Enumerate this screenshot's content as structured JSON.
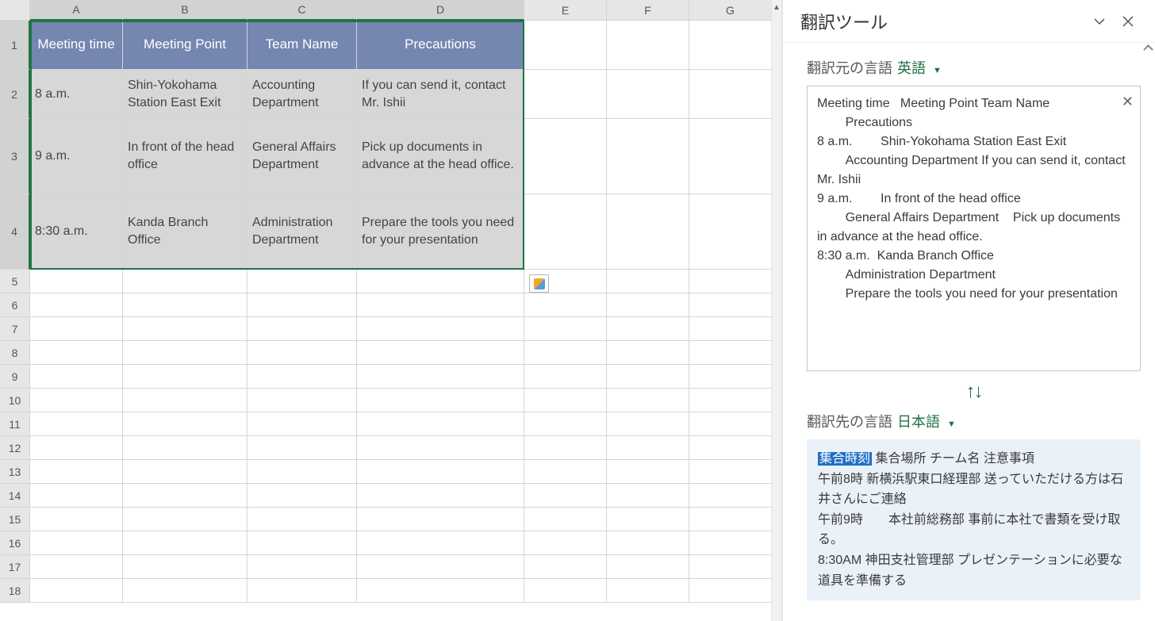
{
  "columns": [
    "A",
    "B",
    "C",
    "D",
    "E",
    "F",
    "G"
  ],
  "rows": [
    "1",
    "2",
    "3",
    "4",
    "5",
    "6",
    "7",
    "8",
    "9",
    "10",
    "11",
    "12",
    "13",
    "14",
    "15",
    "16",
    "17",
    "18"
  ],
  "table": {
    "header": {
      "a": "Meeting time",
      "b": "Meeting Point",
      "c": "Team Name",
      "d": "Precautions"
    },
    "rows": [
      {
        "a": "8 a.m.",
        "b": "Shin-Yokohama Station East Exit",
        "c": "Accounting Department",
        "d": "If you can send it, contact Mr. Ishii"
      },
      {
        "a": "9 a.m.",
        "b": "In front of the head office",
        "c": "General Affairs Department",
        "d": "Pick up documents in advance at the head office."
      },
      {
        "a": "8:30 a.m.",
        "b": "Kanda Branch Office",
        "c": "Administration Department",
        "d": "Prepare the tools you need for your presentation"
      }
    ]
  },
  "pane": {
    "title": "翻訳ツール",
    "source_label": "翻訳元の言語",
    "source_lang": "英語",
    "target_label": "翻訳先の言語",
    "target_lang": "日本語",
    "source_text_lines": [
      "Meeting time   Meeting Point Team Name",
      "        Precautions",
      "8 a.m.        Shin-Yokohama Station East Exit",
      "        Accounting Department If you can send it, contact Mr. Ishii",
      "9 a.m.        In front of the head office",
      "        General Affairs Department    Pick up documents in advance at the head office.",
      "8:30 a.m.  Kanda Branch Office",
      "        Administration Department",
      "        Prepare the tools you need for your presentation"
    ],
    "target_highlight": "集合時刻",
    "target_rest_lines": [
      " 集合場所 チーム名 注意事項",
      "午前8時 新横浜駅東口経理部 送っていただける方は石井さんにご連絡",
      "午前9時　　本社前総務部 事前に本社で書類を受け取る。",
      "8:30AM 神田支社管理部 プレゼンテーションに必要な道具を準備する"
    ]
  }
}
